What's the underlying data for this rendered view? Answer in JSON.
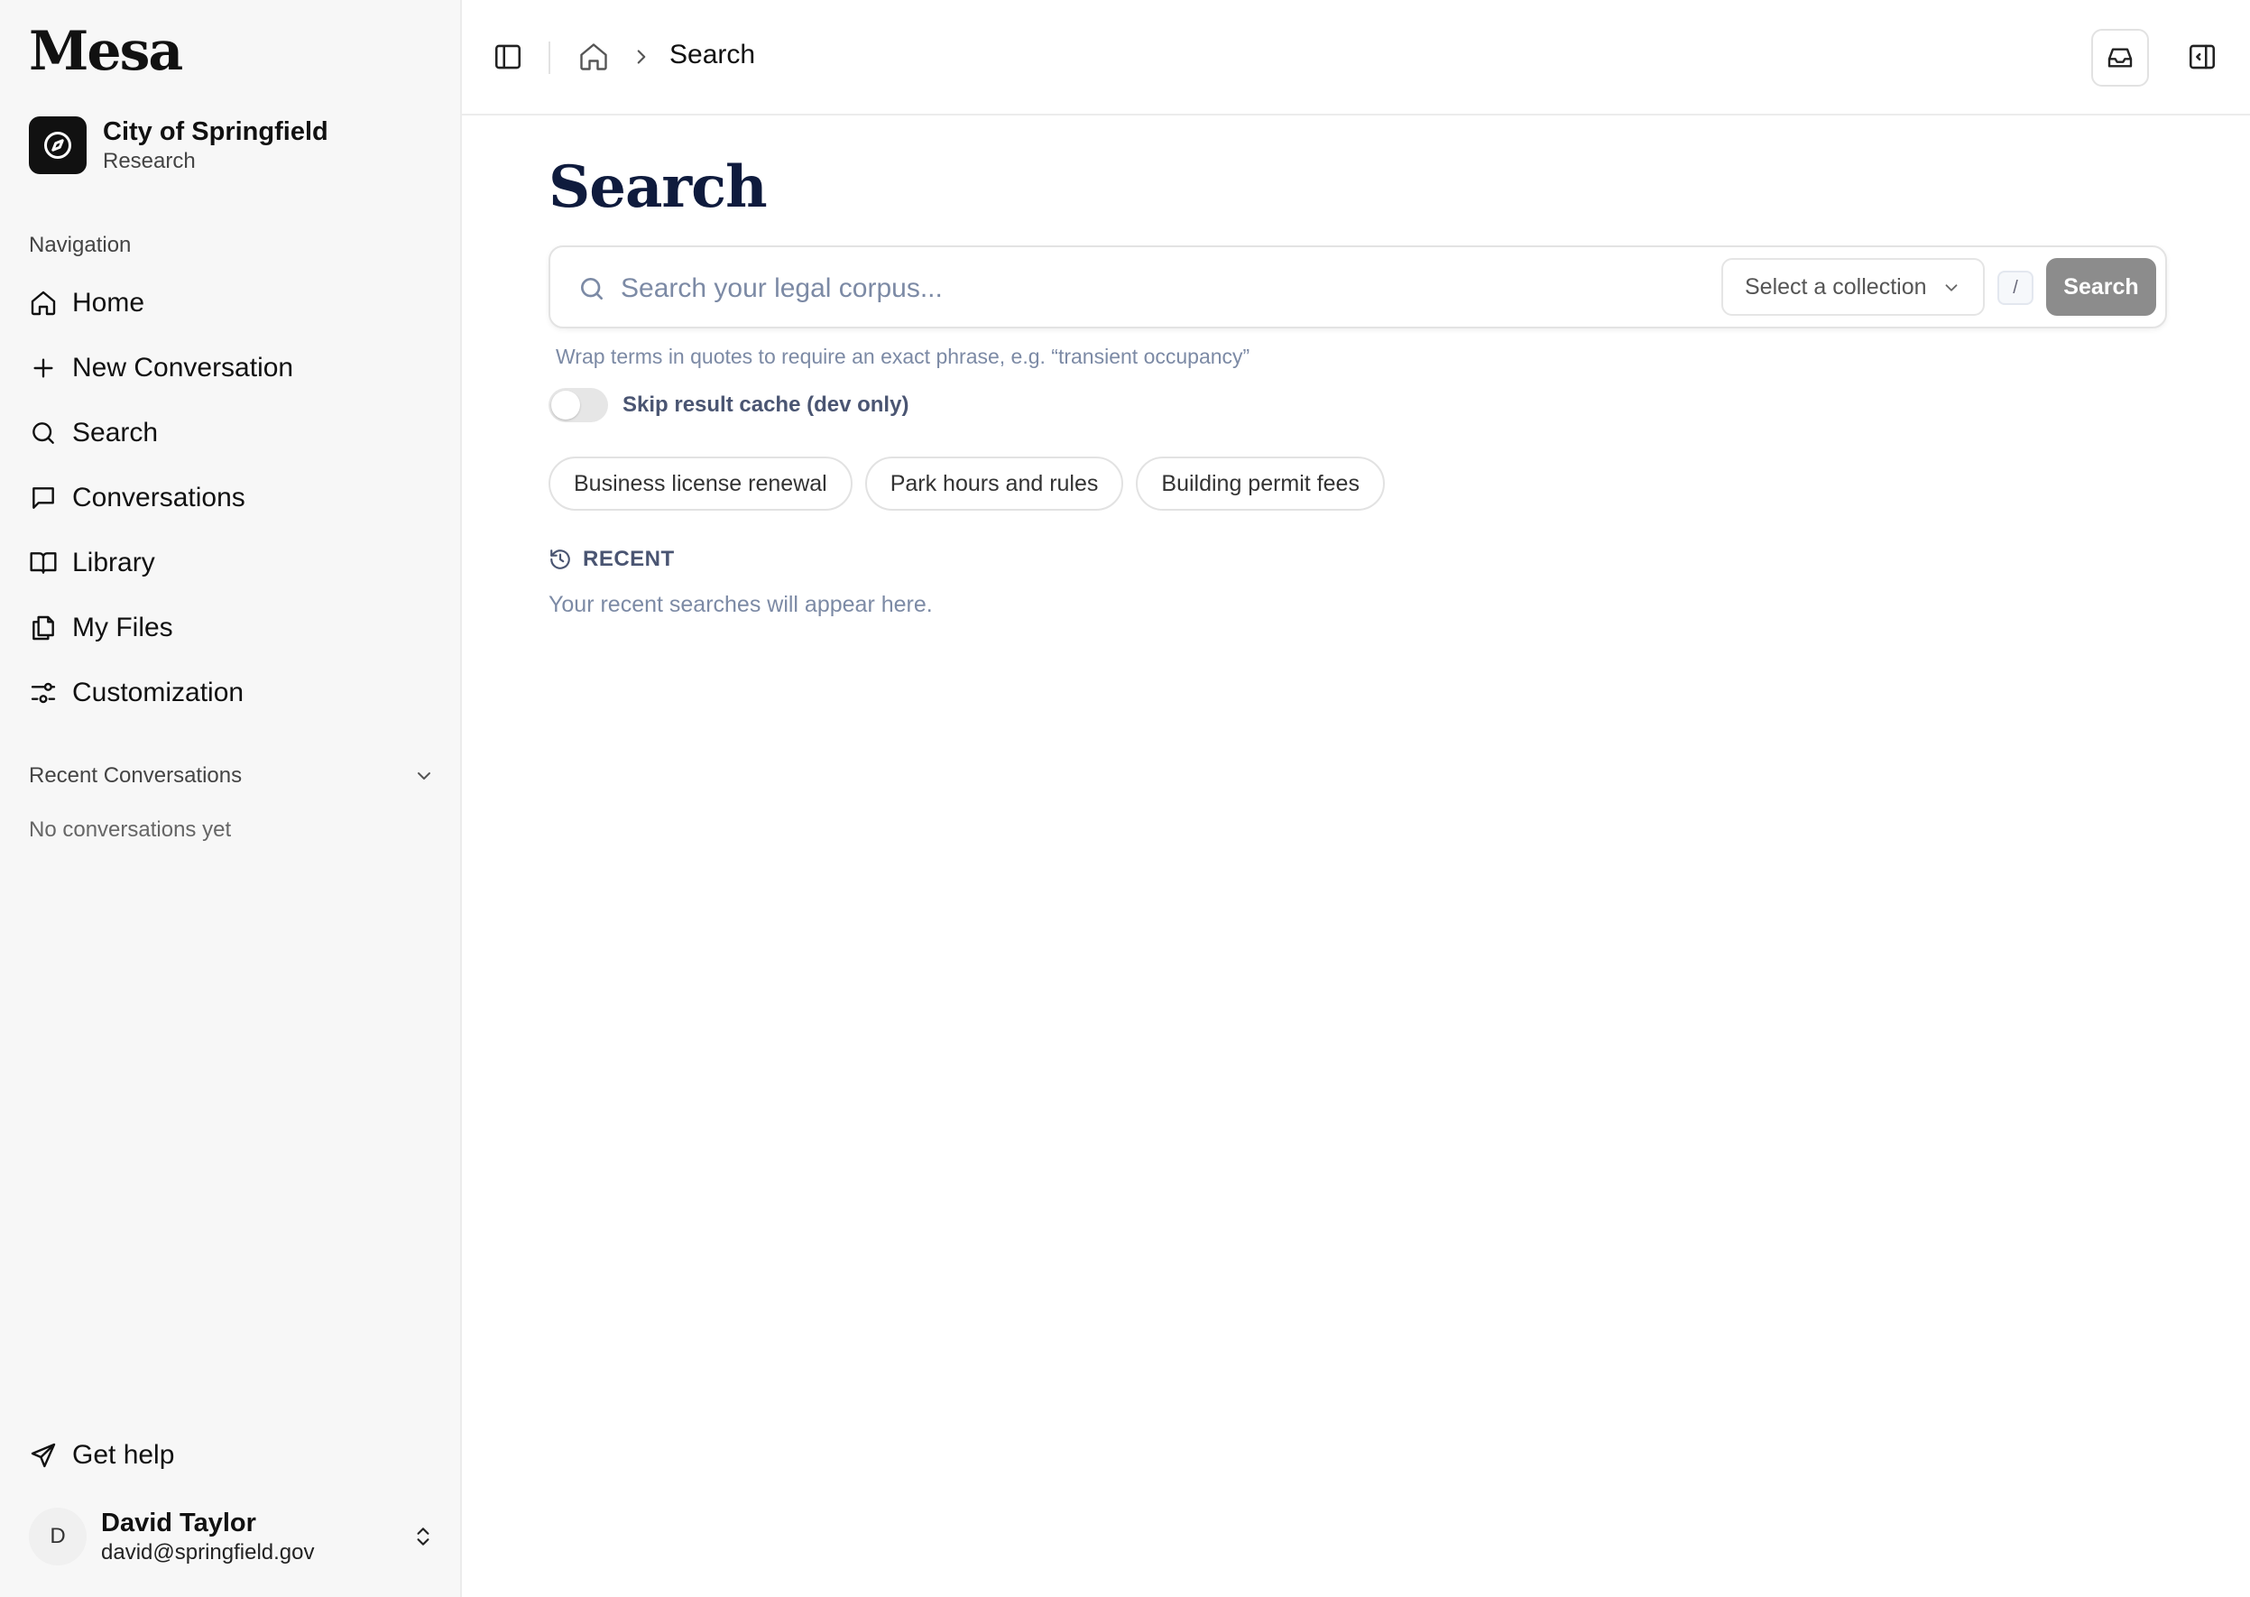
{
  "app": {
    "logo": "Mesa"
  },
  "org": {
    "name": "City of Springfield",
    "subtitle": "Research"
  },
  "sidebar": {
    "nav_heading": "Navigation",
    "items": [
      {
        "label": "Home",
        "icon": "home-icon"
      },
      {
        "label": "New Conversation",
        "icon": "plus-icon"
      },
      {
        "label": "Search",
        "icon": "search-icon"
      },
      {
        "label": "Conversations",
        "icon": "chat-icon"
      },
      {
        "label": "Library",
        "icon": "book-icon"
      },
      {
        "label": "My Files",
        "icon": "files-icon"
      },
      {
        "label": "Customization",
        "icon": "sliders-icon"
      }
    ],
    "recent_heading": "Recent Conversations",
    "recent_empty": "No conversations yet",
    "help": "Get help"
  },
  "user": {
    "initial": "D",
    "name": "David Taylor",
    "email": "david@springfield.gov"
  },
  "topbar": {
    "breadcrumb": "Search"
  },
  "main": {
    "title": "Search",
    "search_placeholder": "Search your legal corpus...",
    "collection_placeholder": "Select a collection",
    "shortcut_key": "/",
    "search_button": "Search",
    "hint": "Wrap terms in quotes to require an exact phrase, e.g. “transient occupancy”",
    "toggle_label": "Skip result cache (dev only)",
    "toggle_on": false,
    "suggestions": [
      "Business license renewal",
      "Park hours and rules",
      "Building permit fees"
    ],
    "recent_label": "RECENT",
    "recent_empty": "Your recent searches will appear here."
  },
  "colors": {
    "sidebar_bg": "#f7f7f7",
    "title": "#0f1b3d",
    "muted": "#7c8aa5",
    "button_disabled": "#8c8c8c"
  }
}
